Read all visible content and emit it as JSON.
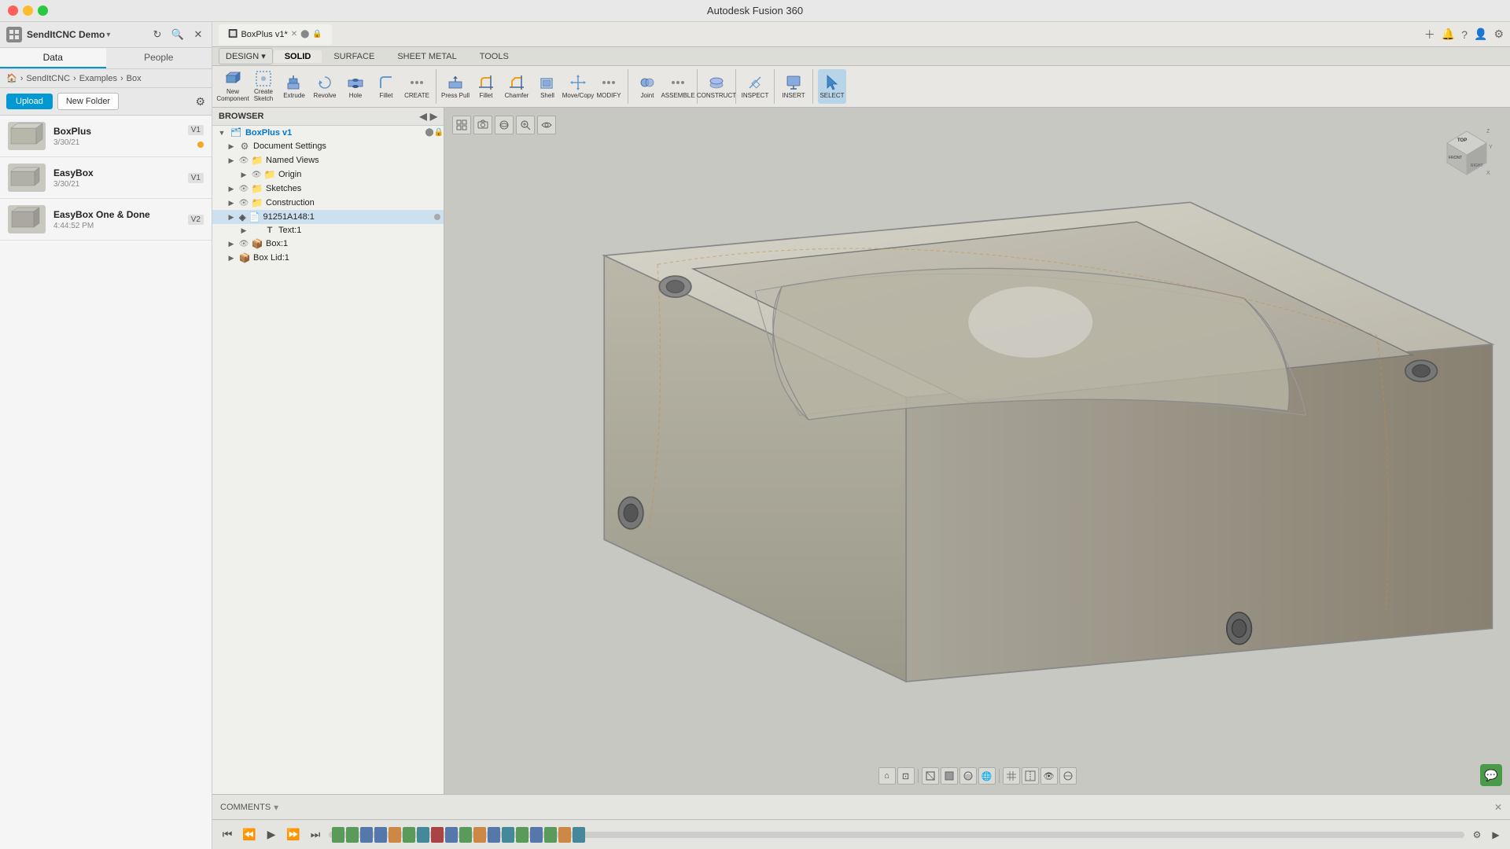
{
  "window": {
    "title": "Autodesk Fusion 360"
  },
  "titlebar": {
    "title": "Autodesk Fusion 360"
  },
  "sidebar": {
    "app_name": "SendItCNC Demo",
    "tabs": [
      "Data",
      "People"
    ],
    "active_tab": "Data",
    "upload_label": "Upload",
    "new_folder_label": "New Folder",
    "breadcrumb": [
      "🏠",
      "SendItCNC",
      ">",
      "Examples",
      ">",
      "Box"
    ],
    "files": [
      {
        "name": "BoxPlus",
        "date": "3/30/21",
        "version": "V1",
        "has_dot": true,
        "dot_color": "#f5a623"
      },
      {
        "name": "EasyBox",
        "date": "3/30/21",
        "version": "V1",
        "has_dot": false
      },
      {
        "name": "EasyBox One & Done",
        "date": "4:44:52 PM",
        "version": "V2",
        "has_dot": false
      }
    ]
  },
  "toolbar": {
    "tabs": [
      "SOLID",
      "SURFACE",
      "SHEET METAL",
      "TOOLS"
    ],
    "active_tab": "SOLID",
    "design_label": "DESIGN",
    "sections": {
      "create_label": "CREATE",
      "modify_label": "MODIFY",
      "assemble_label": "ASSEMBLE",
      "construct_label": "CONSTRUCT",
      "inspect_label": "INSPECT",
      "insert_label": "INSERT",
      "select_label": "SELECT"
    }
  },
  "browser": {
    "title": "BROWSER",
    "tree": {
      "root": "BoxPlus v1",
      "items": [
        {
          "id": "document-settings",
          "label": "Document Settings",
          "indent": 1,
          "icon": "⚙"
        },
        {
          "id": "named-views",
          "label": "Named Views",
          "indent": 1,
          "icon": "📁"
        },
        {
          "id": "origin",
          "label": "Origin",
          "indent": 2,
          "icon": "📁"
        },
        {
          "id": "sketches",
          "label": "Sketches",
          "indent": 1,
          "icon": "📁"
        },
        {
          "id": "construction",
          "label": "Construction",
          "indent": 1,
          "icon": "📁"
        },
        {
          "id": "component-91251",
          "label": "91251A148:1",
          "indent": 1,
          "icon": "📄",
          "has_badge": true
        },
        {
          "id": "text-1",
          "label": "Text:1",
          "indent": 2,
          "icon": "T"
        },
        {
          "id": "box-1",
          "label": "Box:1",
          "indent": 1,
          "icon": "📦"
        },
        {
          "id": "box-lid-1",
          "label": "Box Lid:1",
          "indent": 1,
          "icon": "📦"
        }
      ]
    }
  },
  "document": {
    "tab_name": "BoxPlus v1*",
    "modified": true
  },
  "viewport": {
    "construct_overlay": "CONSTRUCT >"
  },
  "comments": {
    "label": "COMMENTS"
  },
  "timeline": {
    "items": [
      {
        "type": "green"
      },
      {
        "type": "green"
      },
      {
        "type": "blue"
      },
      {
        "type": "blue"
      },
      {
        "type": "orange"
      },
      {
        "type": "green"
      },
      {
        "type": "teal"
      },
      {
        "type": "red"
      },
      {
        "type": "blue"
      },
      {
        "type": "green"
      },
      {
        "type": "orange"
      },
      {
        "type": "blue"
      },
      {
        "type": "teal"
      },
      {
        "type": "green"
      },
      {
        "type": "blue"
      },
      {
        "type": "green"
      },
      {
        "type": "orange"
      },
      {
        "type": "teal"
      }
    ]
  }
}
